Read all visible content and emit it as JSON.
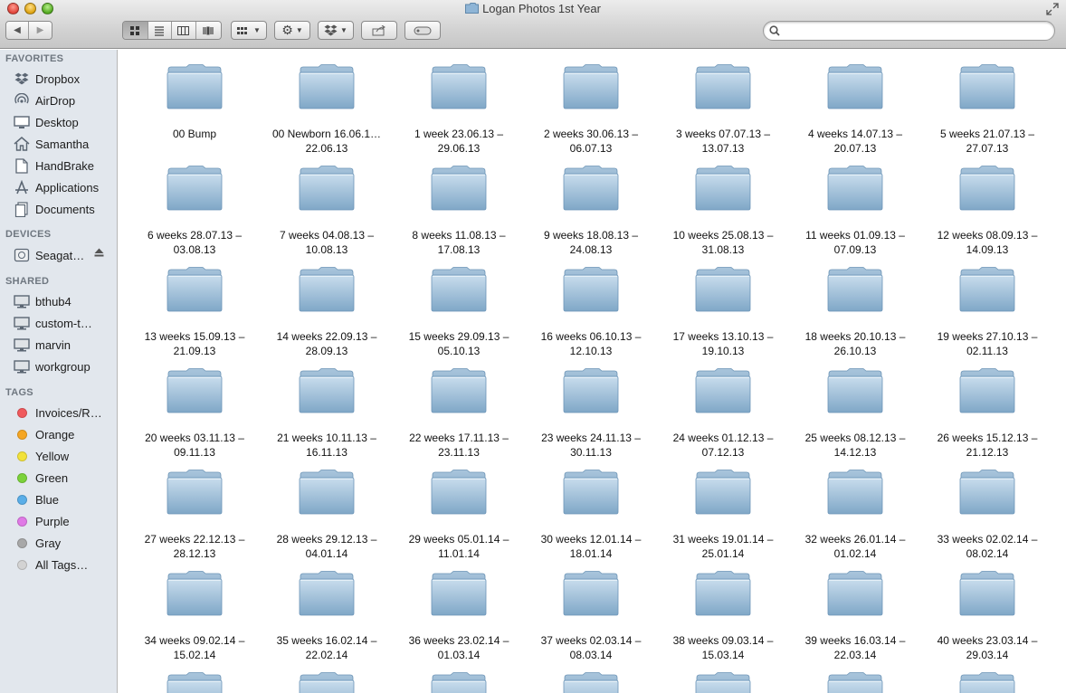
{
  "window": {
    "title": "Logan Photos 1st Year"
  },
  "toolbar": {
    "back_label": "◀",
    "forward_label": "▶",
    "search_placeholder": ""
  },
  "sidebar": {
    "sections": [
      {
        "title": "FAVORITES",
        "items": [
          {
            "label": "Dropbox",
            "icon": "dropbox-icon"
          },
          {
            "label": "AirDrop",
            "icon": "airdrop-icon"
          },
          {
            "label": "Desktop",
            "icon": "desktop-icon"
          },
          {
            "label": "Samantha",
            "icon": "home-icon"
          },
          {
            "label": "HandBrake",
            "icon": "document-icon"
          },
          {
            "label": "Applications",
            "icon": "applications-icon"
          },
          {
            "label": "Documents",
            "icon": "documents-icon"
          }
        ]
      },
      {
        "title": "DEVICES",
        "items": [
          {
            "label": "Seagat…",
            "icon": "drive-icon"
          }
        ]
      },
      {
        "title": "SHARED",
        "items": [
          {
            "label": "bthub4",
            "icon": "computer-icon"
          },
          {
            "label": "custom-t…",
            "icon": "computer-icon"
          },
          {
            "label": "marvin",
            "icon": "computer-icon"
          },
          {
            "label": "workgroup",
            "icon": "computer-icon"
          }
        ]
      },
      {
        "title": "TAGS",
        "items": [
          {
            "label": "Invoices/R…",
            "color": "#f0595c"
          },
          {
            "label": "Orange",
            "color": "#f5a623"
          },
          {
            "label": "Yellow",
            "color": "#f2e23a"
          },
          {
            "label": "Green",
            "color": "#7bd23a"
          },
          {
            "label": "Blue",
            "color": "#5aaee8"
          },
          {
            "label": "Purple",
            "color": "#e07ae6"
          },
          {
            "label": "Gray",
            "color": "#a8a8a8"
          },
          {
            "label": "All Tags…",
            "color": "#d3d3d3"
          }
        ]
      }
    ]
  },
  "folders": [
    "00 Bump",
    "00 Newborn 16.06.1…22.06.13",
    "1 week 23.06.13 – 29.06.13",
    "2 weeks 30.06.13 – 06.07.13",
    "3 weeks 07.07.13 – 13.07.13",
    "4 weeks 14.07.13 – 20.07.13",
    "5 weeks 21.07.13 – 27.07.13",
    "6 weeks 28.07.13 – 03.08.13",
    "7 weeks 04.08.13 – 10.08.13",
    "8 weeks 11.08.13 – 17.08.13",
    "9 weeks 18.08.13 – 24.08.13",
    "10 weeks 25.08.13 – 31.08.13",
    "11 weeks 01.09.13 – 07.09.13",
    "12 weeks 08.09.13 – 14.09.13",
    "13 weeks 15.09.13 – 21.09.13",
    "14 weeks 22.09.13 – 28.09.13",
    "15 weeks 29.09.13 – 05.10.13",
    "16 weeks 06.10.13 – 12.10.13",
    "17 weeks 13.10.13 – 19.10.13",
    "18 weeks 20.10.13 – 26.10.13",
    "19 weeks 27.10.13 – 02.11.13",
    "20 weeks 03.11.13 – 09.11.13",
    "21 weeks 10.11.13 – 16.11.13",
    "22 weeks 17.11.13 – 23.11.13",
    "23 weeks 24.11.13 – 30.11.13",
    "24 weeks 01.12.13 – 07.12.13",
    "25 weeks 08.12.13 – 14.12.13",
    "26 weeks 15.12.13 – 21.12.13",
    "27 weeks 22.12.13 – 28.12.13",
    "28 weeks 29.12.13 – 04.01.14",
    "29 weeks 05.01.14 – 11.01.14",
    "30 weeks 12.01.14 – 18.01.14",
    "31 weeks 19.01.14 – 25.01.14",
    "32 weeks 26.01.14 – 01.02.14",
    "33 weeks 02.02.14 – 08.02.14",
    "34 weeks 09.02.14 – 15.02.14",
    "35 weeks 16.02.14 – 22.02.14",
    "36 weeks 23.02.14 – 01.03.14",
    "37 weeks 02.03.14 – 08.03.14",
    "38 weeks 09.03.14 – 15.03.14",
    "39 weeks 16.03.14 – 22.03.14",
    "40 weeks 23.03.14 – 29.03.14"
  ],
  "partial_row_count": 7,
  "colors": {
    "folder_top": "#c9dded",
    "folder_bottom": "#7fa7c7",
    "sidebar_bg": "#e2e7ed"
  }
}
